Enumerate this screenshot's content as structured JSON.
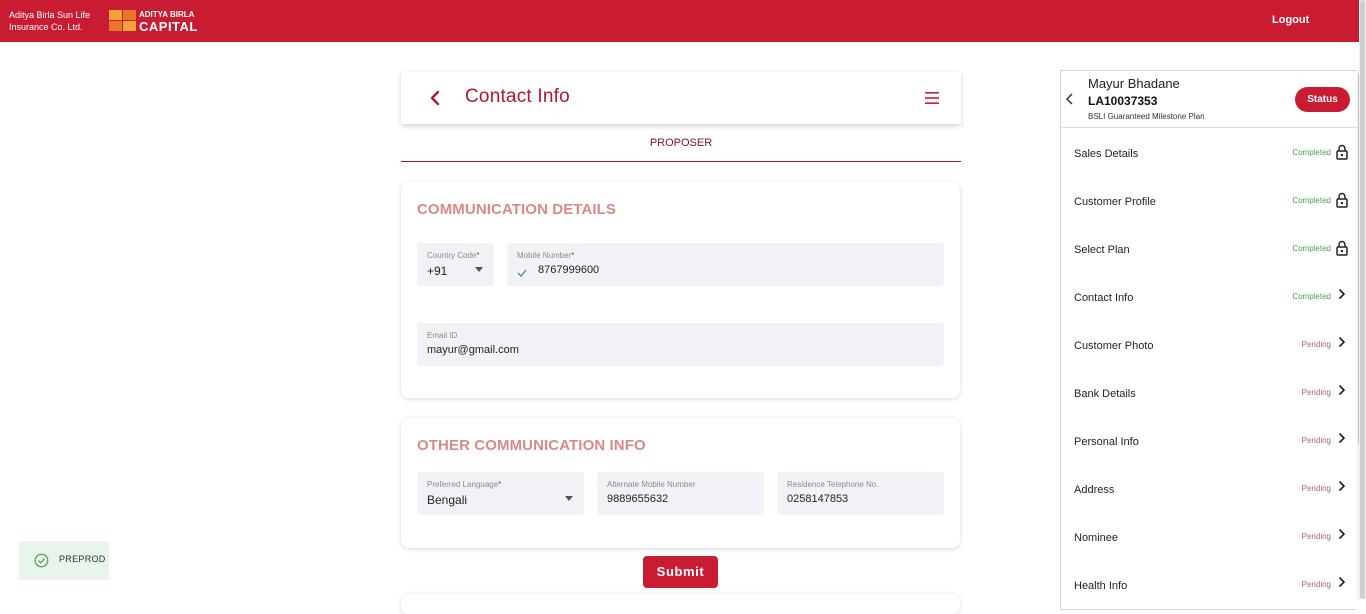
{
  "header": {
    "brand_line1": "Aditya Birla Sun Life",
    "brand_line2": "Insurance Co. Ltd.",
    "capital_line1": "ADITYA BIRLA",
    "capital_line2": "CAPITAL",
    "logout_label": "Logout",
    "color": "#c91c33"
  },
  "page": {
    "title": "Contact Info",
    "tab_label": "PROPOSER",
    "submit_label": "Submit"
  },
  "communication_details": {
    "title": "COMMUNICATION DETAILS",
    "country_code": {
      "label": "Country Code",
      "value": "+91"
    },
    "mobile_number": {
      "label": "Mobile Number",
      "value": "8767999600"
    },
    "email": {
      "label": "Email ID",
      "value": "mayur@gmail.com"
    }
  },
  "other_communication": {
    "title": "OTHER COMMUNICATION INFO",
    "preferred_language": {
      "label": "Preferred Language",
      "value": "Bengali"
    },
    "alternate_mobile": {
      "label": "Alternate Mobile Number",
      "value": "9889655632"
    },
    "residence_telephone": {
      "label": "Residence Telephone No.",
      "value": "0258147853"
    }
  },
  "env_badge": {
    "label": "PREPROD"
  },
  "sidebar": {
    "customer_name": "Mayur Bhadane",
    "application_id": "LA10037353",
    "plan_name": "BSLI Guaranteed Milestone Plan",
    "status_label": "Status",
    "items": [
      {
        "label": "Sales Details",
        "status": "Completed",
        "icon": "lock-icon"
      },
      {
        "label": "Customer Profile",
        "status": "Completed",
        "icon": "lock-icon"
      },
      {
        "label": "Select Plan",
        "status": "Completed",
        "icon": "lock-icon"
      },
      {
        "label": "Contact Info",
        "status": "Completed",
        "icon": "chevron-right-icon"
      },
      {
        "label": "Customer Photo",
        "status": "Pending",
        "icon": "chevron-right-icon"
      },
      {
        "label": "Bank Details",
        "status": "Pending",
        "icon": "chevron-right-icon"
      },
      {
        "label": "Personal Info",
        "status": "Pending",
        "icon": "chevron-right-icon"
      },
      {
        "label": "Address",
        "status": "Pending",
        "icon": "chevron-right-icon"
      },
      {
        "label": "Nominee",
        "status": "Pending",
        "icon": "chevron-right-icon"
      },
      {
        "label": "Health Info",
        "status": "Pending",
        "icon": "chevron-right-icon"
      }
    ]
  }
}
